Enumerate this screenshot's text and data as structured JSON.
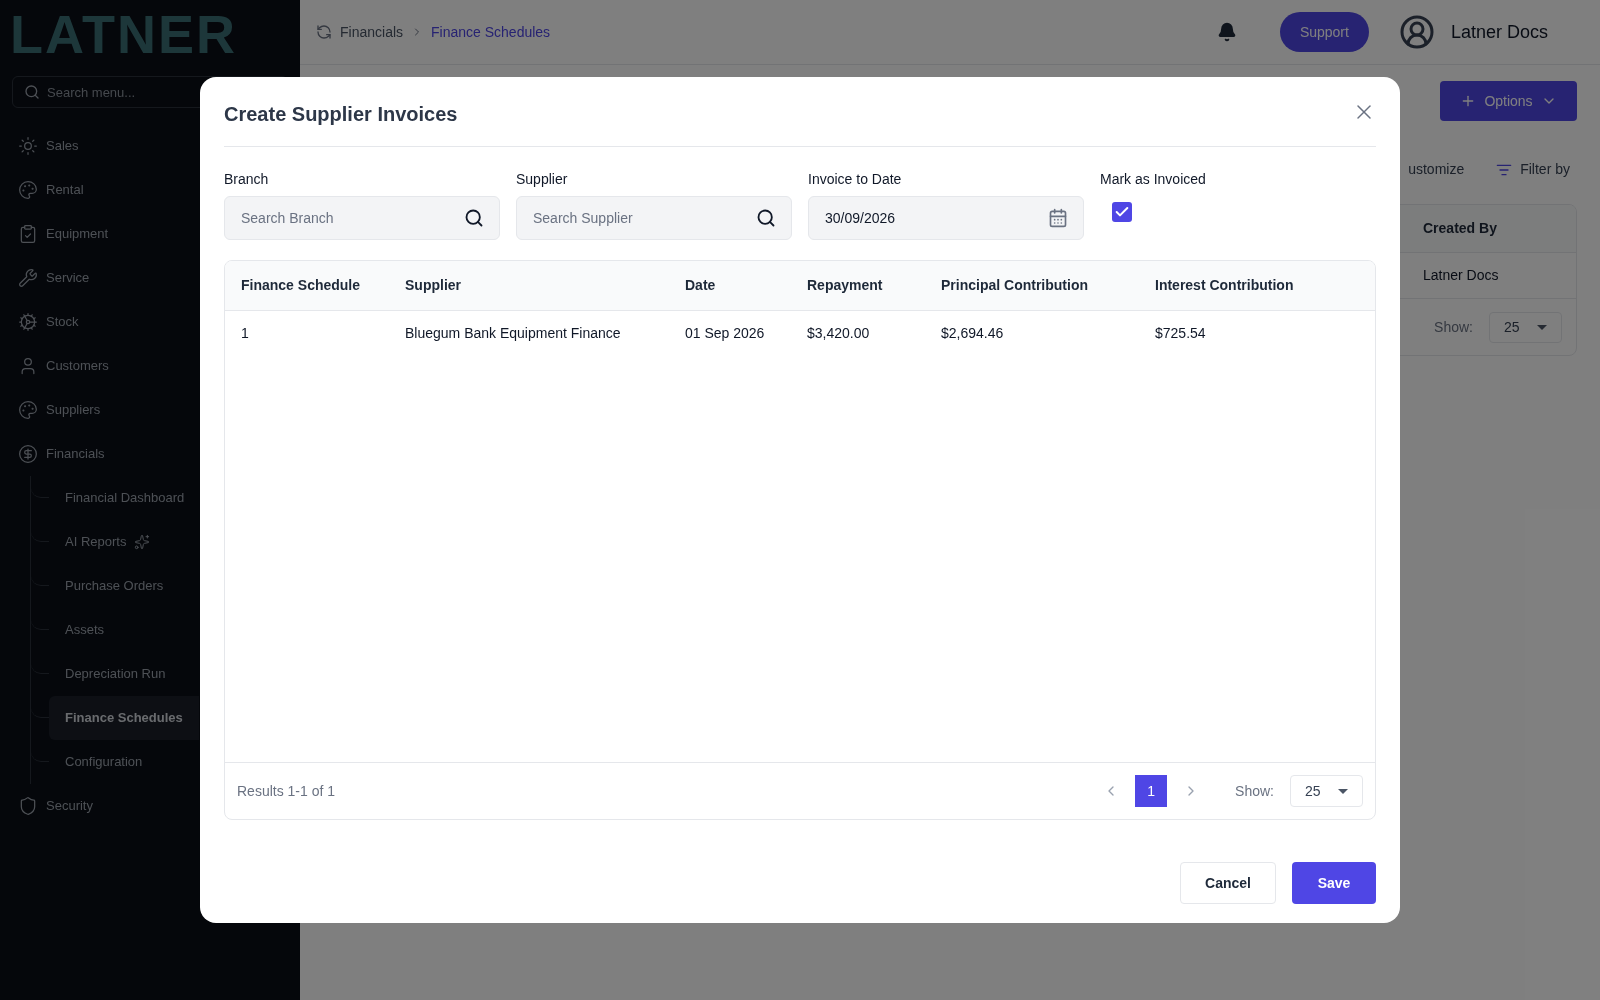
{
  "sidebar": {
    "logo": "LATNER",
    "search": {
      "placeholder": "Search menu..."
    },
    "items": [
      {
        "label": "Sales",
        "selected": false
      },
      {
        "label": "Rental",
        "selected": false
      },
      {
        "label": "Equipment",
        "selected": false
      },
      {
        "label": "Service",
        "selected": false
      },
      {
        "label": "Stock",
        "selected": false
      },
      {
        "label": "Customers",
        "selected": false
      },
      {
        "label": "Suppliers",
        "selected": false
      },
      {
        "label": "Financials",
        "selected": false,
        "children": [
          {
            "label": "Financial Dashboard",
            "selected": false
          },
          {
            "label": "AI Reports",
            "selected": false,
            "ai_badge": true
          },
          {
            "label": "Purchase Orders",
            "selected": false
          },
          {
            "label": "Assets",
            "selected": false
          },
          {
            "label": "Depreciation Run",
            "selected": false
          },
          {
            "label": "Finance Schedules",
            "selected": true
          },
          {
            "label": "Configuration",
            "selected": false
          }
        ]
      },
      {
        "label": "Security",
        "selected": false
      }
    ]
  },
  "topbar": {
    "breadcrumb": [
      {
        "label": "Financials",
        "selected": false
      },
      {
        "label": "Finance Schedules",
        "selected": true
      }
    ],
    "support": "Support",
    "user": "Latner Docs"
  },
  "background": {
    "options_button": "Options",
    "toolbar": [
      "ustomize",
      "Filter by"
    ],
    "table": {
      "columns": [
        "Created By"
      ],
      "rows": [
        [
          "Latner Docs"
        ]
      ]
    },
    "show_label": "Show:",
    "page_size": "25"
  },
  "modal": {
    "title": "Create Supplier Invoices",
    "fields": [
      {
        "label": "Branch",
        "kind": "search",
        "placeholder": "Search Branch"
      },
      {
        "label": "Supplier",
        "kind": "search",
        "placeholder": "Search Supplier"
      },
      {
        "label": "Invoice to Date",
        "kind": "date",
        "value": "30/09/2026"
      },
      {
        "label": "Mark as Invoiced",
        "kind": "checkbox",
        "checked": true
      }
    ],
    "table": {
      "columns": [
        "Finance Schedule",
        "Supplier",
        "Date",
        "Repayment",
        "Principal Contribution",
        "Interest Contribution"
      ],
      "rows": [
        [
          "1",
          "Bluegum Bank Equipment Finance",
          "01 Sep 2026",
          "$3,420.00",
          "$2,694.46",
          "$725.54"
        ]
      ]
    },
    "results": "Results 1-1 of 1",
    "pages": [
      {
        "label": "1",
        "selected": true
      }
    ],
    "show_label": "Show:",
    "page_size": "25",
    "buttons": [
      {
        "label": "Cancel",
        "kind": "secondary"
      },
      {
        "label": "Save",
        "kind": "primary"
      }
    ]
  }
}
